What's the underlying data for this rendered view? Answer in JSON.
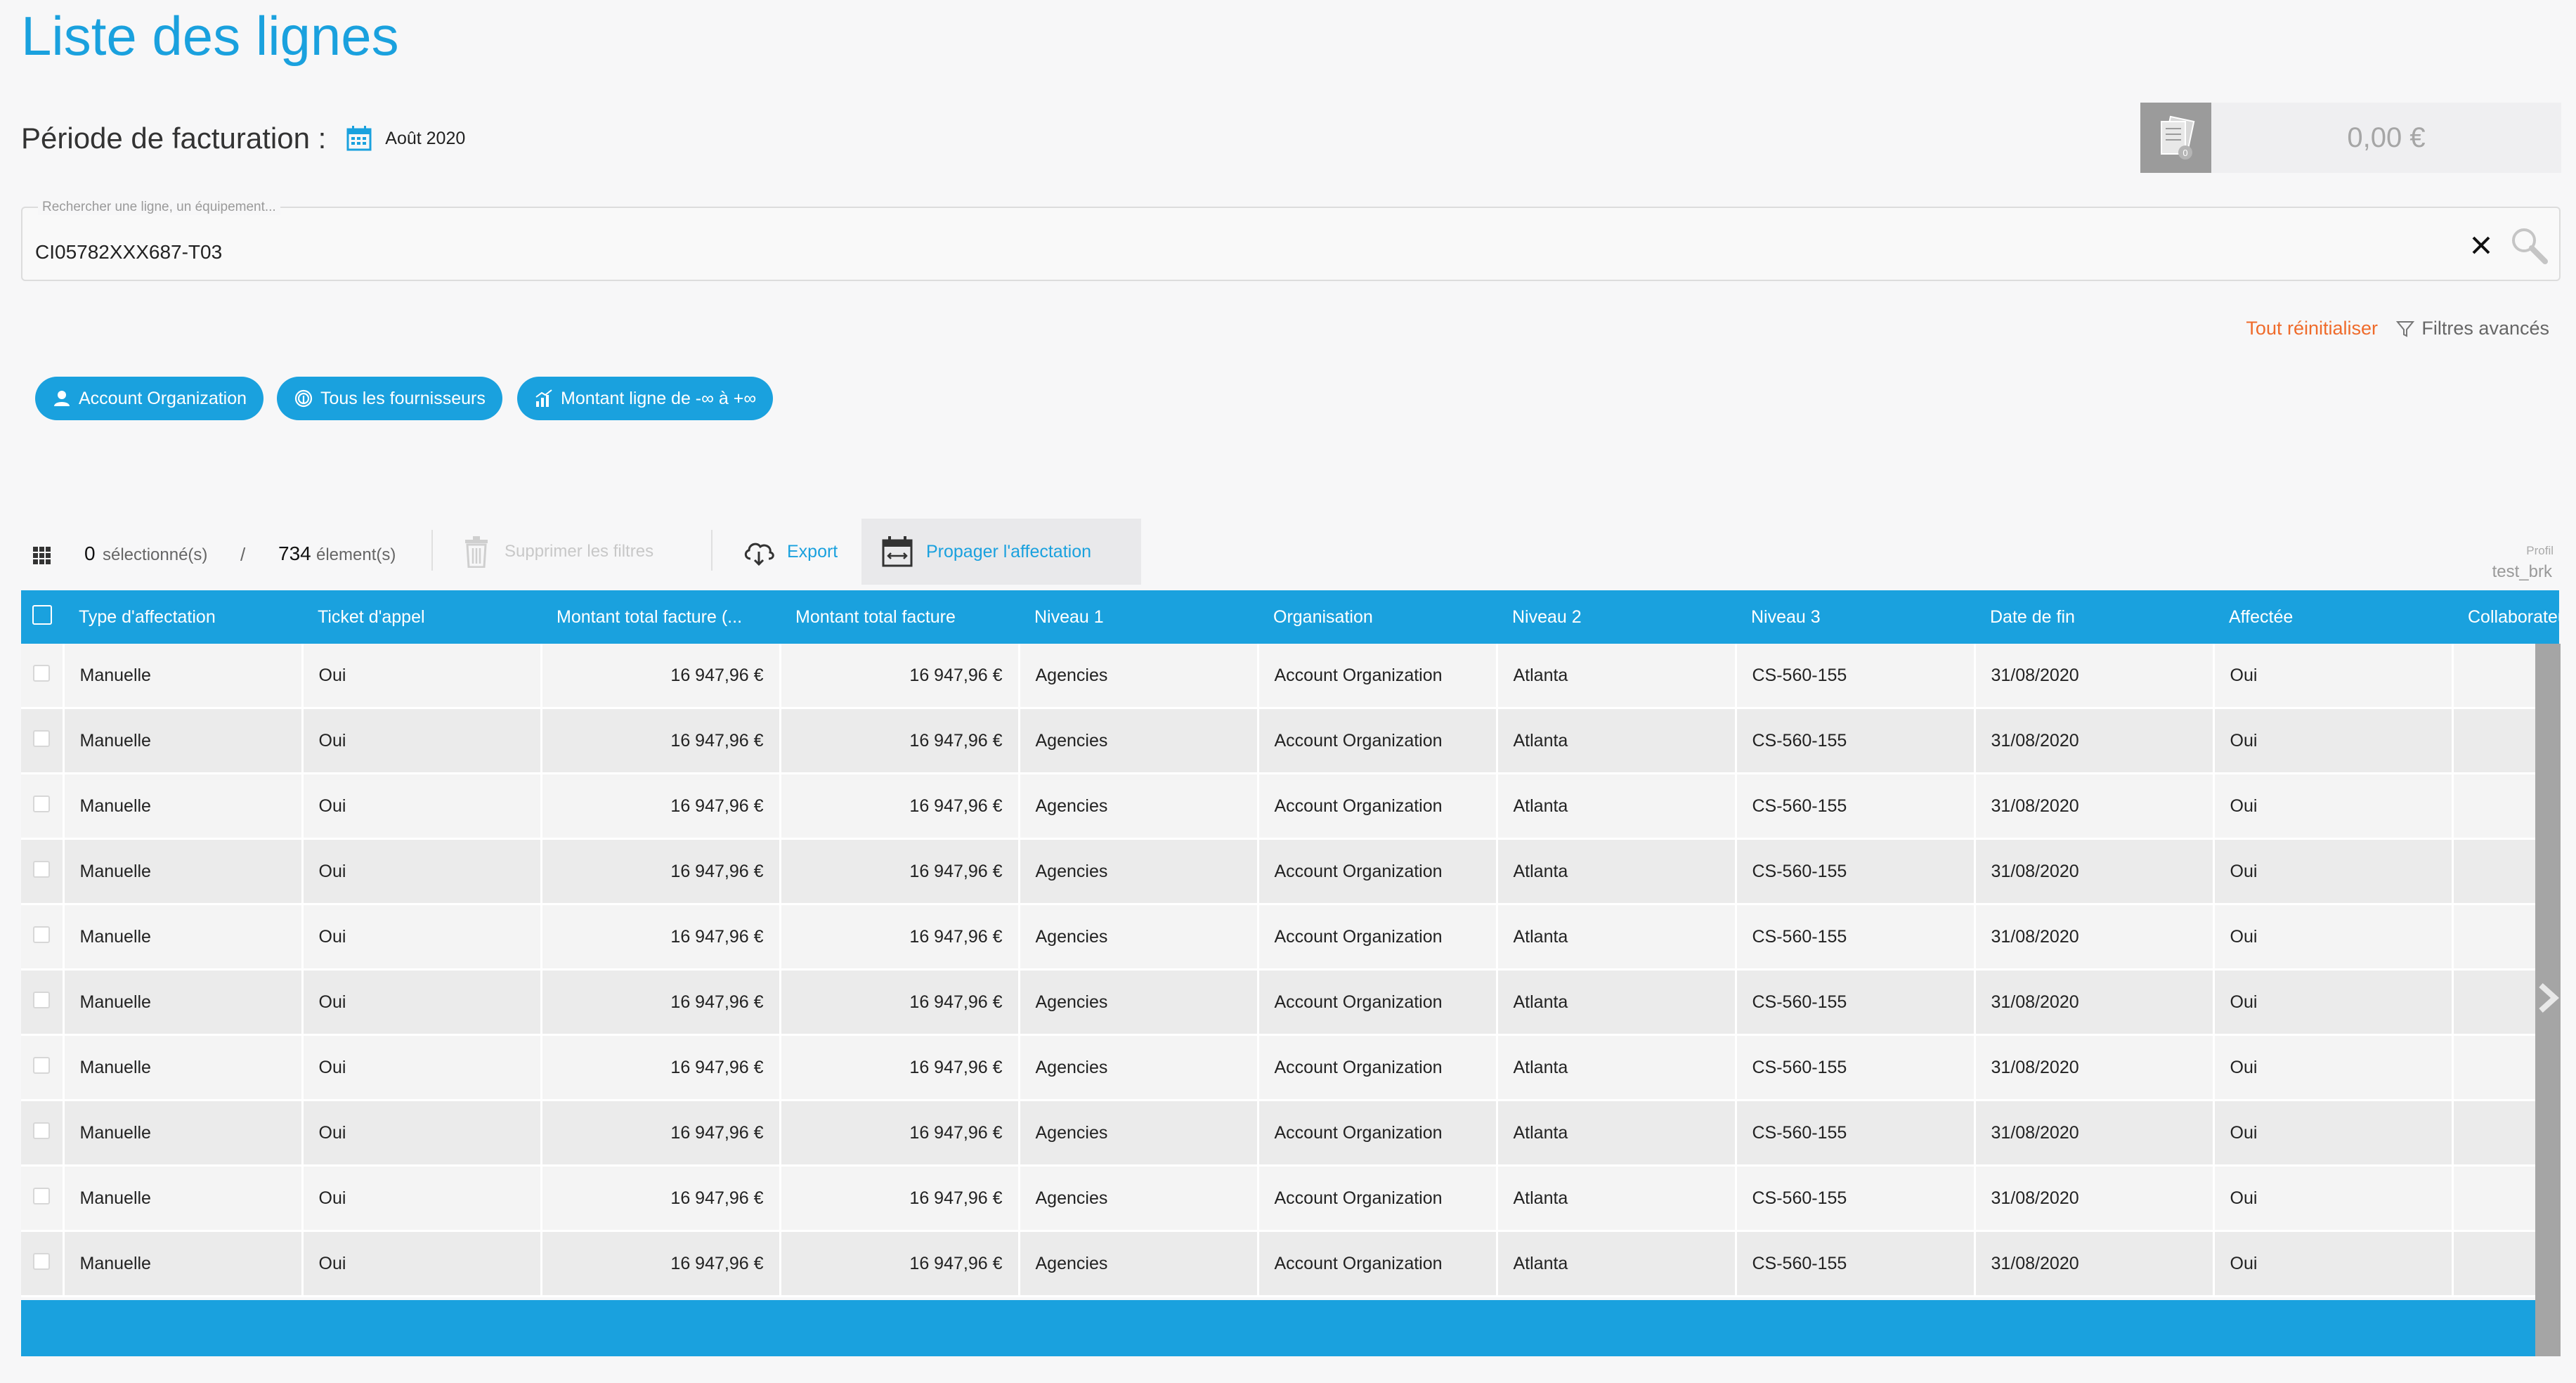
{
  "page": {
    "title": "Liste des lignes"
  },
  "period": {
    "label": "Période de facturation :",
    "value": "Août 2020"
  },
  "total": {
    "badge_count": "0",
    "amount": "0,00 €"
  },
  "search": {
    "placeholder": "Rechercher une ligne, un équipement...",
    "value": "CI05782XXX687-T03"
  },
  "filters": {
    "reset_label": "Tout réinitialiser",
    "advanced_label": "Filtres avancés",
    "chips": [
      "Account Organization",
      "Tous les fournisseurs",
      "Montant ligne de -∞ à +∞"
    ]
  },
  "toolbar": {
    "selected_count": "0",
    "selected_label": "sélectionné(s)",
    "separator": "/",
    "total_count": "734",
    "total_label": "élement(s)",
    "clear_filters_label": "Supprimer les filtres",
    "export_label": "Export",
    "propagate_label": "Propager l'affectation"
  },
  "profile": {
    "label": "Profil",
    "user": "test_brk"
  },
  "table": {
    "columns": [
      "Type d'affectation",
      "Ticket d'appel",
      "Montant total facture (...",
      "Montant total facture",
      "Niveau 1",
      "Organisation",
      "Niveau 2",
      "Niveau 3",
      "Date de fin",
      "Affectée",
      "Collaborateur"
    ],
    "rows": [
      [
        "Manuelle",
        "Oui",
        "16 947,96 €",
        "16 947,96 €",
        "Agencies",
        "Account Organization",
        "Atlanta",
        "CS-560-155",
        "31/08/2020",
        "Oui",
        ""
      ],
      [
        "Manuelle",
        "Oui",
        "16 947,96 €",
        "16 947,96 €",
        "Agencies",
        "Account Organization",
        "Atlanta",
        "CS-560-155",
        "31/08/2020",
        "Oui",
        ""
      ],
      [
        "Manuelle",
        "Oui",
        "16 947,96 €",
        "16 947,96 €",
        "Agencies",
        "Account Organization",
        "Atlanta",
        "CS-560-155",
        "31/08/2020",
        "Oui",
        ""
      ],
      [
        "Manuelle",
        "Oui",
        "16 947,96 €",
        "16 947,96 €",
        "Agencies",
        "Account Organization",
        "Atlanta",
        "CS-560-155",
        "31/08/2020",
        "Oui",
        ""
      ],
      [
        "Manuelle",
        "Oui",
        "16 947,96 €",
        "16 947,96 €",
        "Agencies",
        "Account Organization",
        "Atlanta",
        "CS-560-155",
        "31/08/2020",
        "Oui",
        ""
      ],
      [
        "Manuelle",
        "Oui",
        "16 947,96 €",
        "16 947,96 €",
        "Agencies",
        "Account Organization",
        "Atlanta",
        "CS-560-155",
        "31/08/2020",
        "Oui",
        ""
      ],
      [
        "Manuelle",
        "Oui",
        "16 947,96 €",
        "16 947,96 €",
        "Agencies",
        "Account Organization",
        "Atlanta",
        "CS-560-155",
        "31/08/2020",
        "Oui",
        ""
      ],
      [
        "Manuelle",
        "Oui",
        "16 947,96 €",
        "16 947,96 €",
        "Agencies",
        "Account Organization",
        "Atlanta",
        "CS-560-155",
        "31/08/2020",
        "Oui",
        ""
      ],
      [
        "Manuelle",
        "Oui",
        "16 947,96 €",
        "16 947,96 €",
        "Agencies",
        "Account Organization",
        "Atlanta",
        "CS-560-155",
        "31/08/2020",
        "Oui",
        ""
      ],
      [
        "Manuelle",
        "Oui",
        "16 947,96 €",
        "16 947,96 €",
        "Agencies",
        "Account Organization",
        "Atlanta",
        "CS-560-155",
        "31/08/2020",
        "Oui",
        ""
      ]
    ]
  },
  "colors": {
    "accent": "#1aa1de",
    "reset": "#ef6b2b"
  },
  "icons": [
    "calendar-icon",
    "invoice-icon",
    "close-icon",
    "search-icon",
    "filter-icon",
    "user-icon",
    "fingerprint-icon",
    "chart-icon",
    "grid-icon",
    "trash-icon",
    "cloud-download-icon",
    "calendar-swap-icon",
    "chevron-right-icon"
  ]
}
